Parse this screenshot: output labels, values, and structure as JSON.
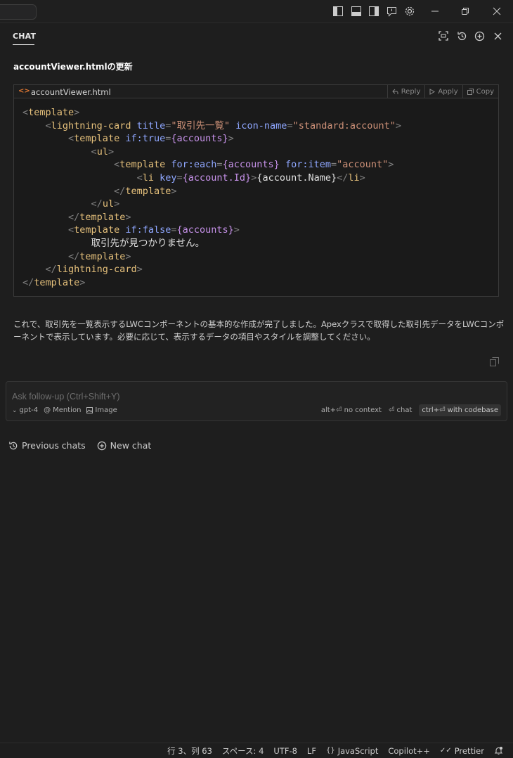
{
  "titlebar": {
    "icons": [
      "toggle-primary-sidebar-icon",
      "toggle-panel-icon",
      "toggle-secondary-sidebar-icon",
      "feedback-icon",
      "settings-gear-icon",
      "minimize-icon",
      "restore-icon",
      "close-icon"
    ]
  },
  "chat": {
    "tab_label": "CHAT",
    "response_title": "accountViewer.htmlの更新",
    "header_icons": [
      "expand-icon",
      "history-icon",
      "new-chat-icon",
      "close-icon"
    ]
  },
  "codeblock": {
    "filename": "accountViewer.html",
    "actions": {
      "reply": "Reply",
      "apply": "Apply",
      "copy": "Copy"
    },
    "lines": [
      [
        [
          "br",
          "<"
        ],
        [
          "tag",
          "template"
        ],
        [
          "br",
          ">"
        ]
      ],
      [
        [
          "plain",
          "    "
        ],
        [
          "br",
          "<"
        ],
        [
          "tag",
          "lightning-card"
        ],
        [
          "plain",
          " "
        ],
        [
          "attr",
          "title"
        ],
        [
          "br",
          "="
        ],
        [
          "str",
          "\"取引先一覧\""
        ],
        [
          "plain",
          " "
        ],
        [
          "attr",
          "icon-name"
        ],
        [
          "br",
          "="
        ],
        [
          "str",
          "\"standard:account\""
        ],
        [
          "br",
          ">"
        ]
      ],
      [
        [
          "plain",
          "        "
        ],
        [
          "br",
          "<"
        ],
        [
          "tag",
          "template"
        ],
        [
          "plain",
          " "
        ],
        [
          "attr",
          "if:true"
        ],
        [
          "br",
          "="
        ],
        [
          "expr",
          "{accounts}"
        ],
        [
          "br",
          ">"
        ]
      ],
      [
        [
          "plain",
          "            "
        ],
        [
          "br",
          "<"
        ],
        [
          "tag",
          "ul"
        ],
        [
          "br",
          ">"
        ]
      ],
      [
        [
          "plain",
          "                "
        ],
        [
          "br",
          "<"
        ],
        [
          "tag",
          "template"
        ],
        [
          "plain",
          " "
        ],
        [
          "attr",
          "for:each"
        ],
        [
          "br",
          "="
        ],
        [
          "expr",
          "{accounts}"
        ],
        [
          "plain",
          " "
        ],
        [
          "attr",
          "for:item"
        ],
        [
          "br",
          "="
        ],
        [
          "str",
          "\"account\""
        ],
        [
          "br",
          ">"
        ]
      ],
      [
        [
          "plain",
          "                    "
        ],
        [
          "br",
          "<"
        ],
        [
          "tag",
          "li"
        ],
        [
          "plain",
          " "
        ],
        [
          "attr",
          "key"
        ],
        [
          "br",
          "="
        ],
        [
          "expr",
          "{account.Id}"
        ],
        [
          "br",
          ">"
        ],
        [
          "plain",
          "{account.Name}"
        ],
        [
          "br",
          "</"
        ],
        [
          "tag",
          "li"
        ],
        [
          "br",
          ">"
        ]
      ],
      [
        [
          "plain",
          "                "
        ],
        [
          "br",
          "</"
        ],
        [
          "tag",
          "template"
        ],
        [
          "br",
          ">"
        ]
      ],
      [
        [
          "plain",
          "            "
        ],
        [
          "br",
          "</"
        ],
        [
          "tag",
          "ul"
        ],
        [
          "br",
          ">"
        ]
      ],
      [
        [
          "plain",
          "        "
        ],
        [
          "br",
          "</"
        ],
        [
          "tag",
          "template"
        ],
        [
          "br",
          ">"
        ]
      ],
      [
        [
          "plain",
          "        "
        ],
        [
          "br",
          "<"
        ],
        [
          "tag",
          "template"
        ],
        [
          "plain",
          " "
        ],
        [
          "attr",
          "if:false"
        ],
        [
          "br",
          "="
        ],
        [
          "expr",
          "{accounts}"
        ],
        [
          "br",
          ">"
        ]
      ],
      [
        [
          "plain",
          "            取引先が見つかりません。"
        ]
      ],
      [
        [
          "plain",
          "        "
        ],
        [
          "br",
          "</"
        ],
        [
          "tag",
          "template"
        ],
        [
          "br",
          ">"
        ]
      ],
      [
        [
          "plain",
          "    "
        ],
        [
          "br",
          "</"
        ],
        [
          "tag",
          "lightning-card"
        ],
        [
          "br",
          ">"
        ]
      ],
      [
        [
          "br",
          "</"
        ],
        [
          "tag",
          "template"
        ],
        [
          "br",
          ">"
        ]
      ]
    ]
  },
  "message": {
    "paragraph": "これで、取引先を一覧表示するLWCコンポーネントの基本的な作成が完了しました。Apexクラスで取得した取引先データをLWCコンポーネントで表示しています。必要に応じて、表示するデータの項目やスタイルを調整してください。"
  },
  "input": {
    "placeholder": "Ask follow-up (Ctrl+Shift+Y)",
    "value": "",
    "model": "gpt-4",
    "mention": "Mention",
    "image": "Image",
    "no_context": "alt+⏎ no context",
    "chat": "⏎ chat",
    "with_codebase": "ctrl+⏎ with codebase"
  },
  "links": {
    "previous_chats": "Previous chats",
    "new_chat": "New chat"
  },
  "statusbar": {
    "position": "行 3、列 63",
    "spaces": "スペース: 4",
    "encoding": "UTF-8",
    "eol": "LF",
    "language": "JavaScript",
    "copilot": "Copilot++",
    "prettier": "Prettier"
  },
  "colors": {
    "background": "#1e1e1e",
    "tag": "#e5c07b",
    "attribute": "#8fa7ff",
    "string": "#ce9178",
    "expression": "#c792ea"
  }
}
